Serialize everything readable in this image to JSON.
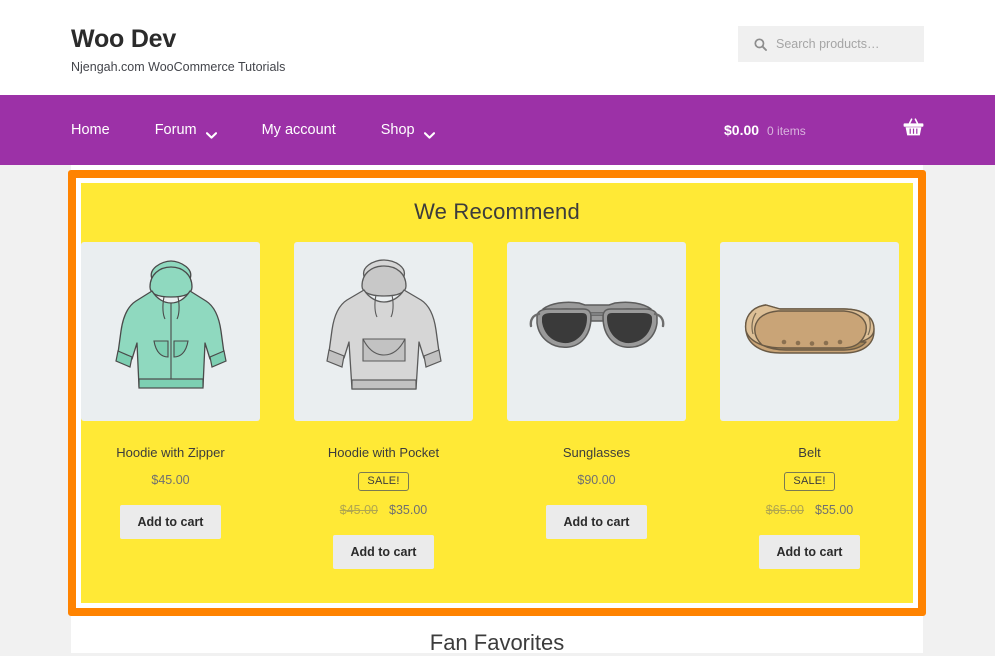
{
  "header": {
    "site_title": "Woo Dev",
    "tagline": "Njengah.com WooCommerce Tutorials",
    "search": {
      "placeholder": "Search products…",
      "value": "",
      "icon": "search-icon"
    }
  },
  "nav": {
    "items": [
      {
        "label": "Home",
        "has_dropdown": false
      },
      {
        "label": "Forum",
        "has_dropdown": true
      },
      {
        "label": "My account",
        "has_dropdown": false
      },
      {
        "label": "Shop",
        "has_dropdown": true
      }
    ],
    "cart": {
      "total": "$0.00",
      "count": "0 items",
      "icon": "shopping-basket-icon"
    },
    "bg_color": "#9c31a7"
  },
  "recommend_section": {
    "title": "We Recommend",
    "border_color": "#ff8300",
    "bg_color": "#ffe936",
    "add_to_cart_label": "Add to cart",
    "sale_badge_label": "SALE!",
    "products": [
      {
        "name": "Hoodie with Zipper",
        "icon": "hoodie-zipper-image",
        "on_sale": false,
        "price": "$45.00",
        "price_old": "",
        "price_new": ""
      },
      {
        "name": "Hoodie with Pocket",
        "icon": "hoodie-pocket-image",
        "on_sale": true,
        "price": "",
        "price_old": "$45.00",
        "price_new": "$35.00"
      },
      {
        "name": "Sunglasses",
        "icon": "sunglasses-image",
        "on_sale": false,
        "price": "$90.00",
        "price_old": "",
        "price_new": ""
      },
      {
        "name": "Belt",
        "icon": "belt-image",
        "on_sale": true,
        "price": "",
        "price_old": "$65.00",
        "price_new": "$55.00"
      }
    ]
  },
  "fan_favorites": {
    "title": "Fan Favorites"
  }
}
